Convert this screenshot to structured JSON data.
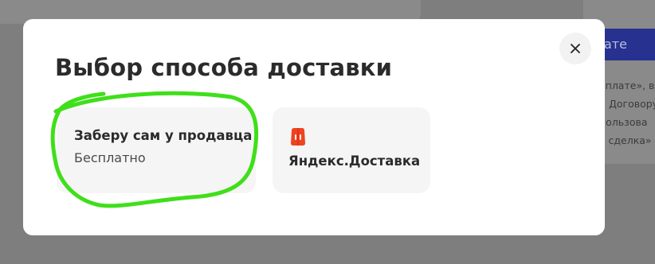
{
  "background": {
    "right_button_label": "ате",
    "right_text_lines": [
      "оплате», в",
      "и Договору",
      "пользова",
      "я сделка»"
    ]
  },
  "modal": {
    "title": "Выбор способа доставки",
    "close_icon": "close-icon",
    "options": [
      {
        "title": "Заберу сам у продавца",
        "subtitle": "Бесплатно"
      },
      {
        "title": "Яндекс.Доставка",
        "icon": "yandex-delivery-icon"
      }
    ]
  },
  "colors": {
    "overlay": "#7e7e7e",
    "modal_bg": "#ffffff",
    "option_bg": "#f5f5f6",
    "annotation": "#3fdf1a",
    "yandex_red": "#f0431f",
    "primary_button": "#27318f"
  }
}
